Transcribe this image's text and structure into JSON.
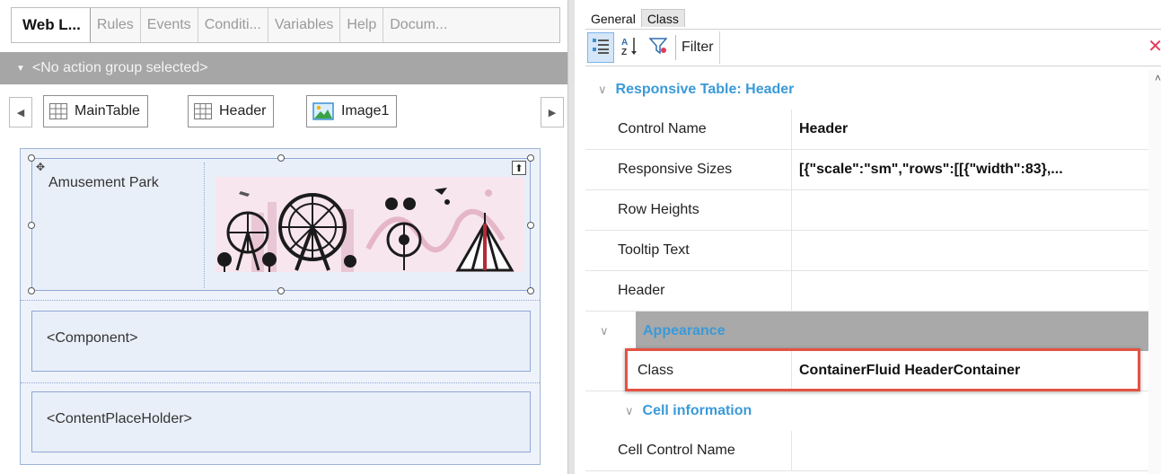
{
  "left_panel": {
    "tabs": [
      {
        "label": "Web L...",
        "active": true
      },
      {
        "label": "Rules",
        "active": false
      },
      {
        "label": "Events",
        "active": false
      },
      {
        "label": "Conditi...",
        "active": false
      },
      {
        "label": "Variables",
        "active": false
      },
      {
        "label": "Help",
        "active": false
      },
      {
        "label": "Docum...",
        "active": false
      }
    ],
    "action_group": "<No action group selected>",
    "breadcrumb": [
      {
        "label": "MainTable",
        "icon": "table-icon"
      },
      {
        "label": "Header",
        "icon": "table-icon"
      },
      {
        "label": "Image1",
        "icon": "image-icon"
      }
    ],
    "designer": {
      "header_text": "Amusement Park",
      "component_text": "<Component>",
      "placeholder_text": "<ContentPlaceHolder>"
    }
  },
  "right_panel": {
    "tabs": [
      {
        "label": "General",
        "active": true
      },
      {
        "label": "Class",
        "active": false
      }
    ],
    "toolbar": {
      "filter_label": "Filter",
      "filter_value": ""
    },
    "section_title": "Responsive Table: Header",
    "properties": [
      {
        "name": "Control Name",
        "value": "Header"
      },
      {
        "name": "Responsive Sizes",
        "value": "[{\"scale\":\"sm\",\"rows\":[[{\"width\":83},..."
      },
      {
        "name": "Row Heights",
        "value": ""
      },
      {
        "name": "Tooltip Text",
        "value": ""
      },
      {
        "name": "Header",
        "value": ""
      }
    ],
    "appearance": {
      "title": "Appearance",
      "class_name": "Class",
      "class_value": "ContainerFluid HeaderContainer"
    },
    "cell_info": {
      "title": "Cell information",
      "rows": [
        {
          "name": "Cell Control Name",
          "value": ""
        }
      ]
    },
    "highlight_color": "#e45242",
    "accent_color": "#3a9ad9"
  }
}
